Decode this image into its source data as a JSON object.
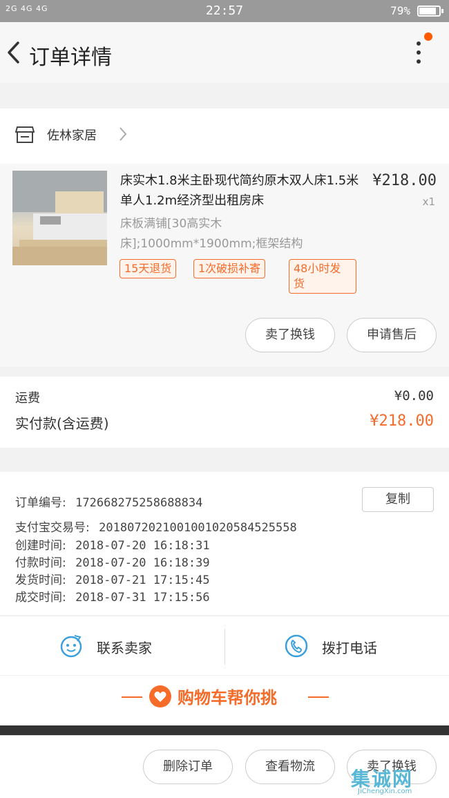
{
  "status_bar": {
    "signal": "2G 4G 4G",
    "time": "22:57",
    "battery_text": "79%",
    "battery_level": 0.79
  },
  "header": {
    "title": "订单详情"
  },
  "shop": {
    "name": "佐林家居"
  },
  "product": {
    "title": "床实木1.8米主卧现代简约原木双人床1.5米单人1.2m经济型出租房床",
    "price": "¥218.00",
    "quantity": "x1",
    "sku": "床板满铺[30高实木床];1000mm*1900mm;框架结构",
    "tags": [
      "15天退货",
      "1次破损补寄",
      "48小时发货"
    ],
    "buttons": {
      "sell_again": "卖了换钱",
      "after_sale": "申请售后"
    }
  },
  "fees": {
    "shipping_label": "运费",
    "shipping_value": "¥0.00",
    "paid_label": "实付款(含运费)",
    "paid_value": "¥218.00"
  },
  "order_info": {
    "order_no_label": "订单编号:",
    "order_no": "172668275258688834",
    "copy_label": "复制",
    "alipay_label": "支付宝交易号:",
    "alipay_no": "2018072021001001020584525558",
    "created_label": "创建时间:",
    "created": "2018-07-20 16:18:31",
    "paid_label": "付款时间:",
    "paid": "2018-07-20 16:18:39",
    "shipped_label": "发货时间:",
    "shipped": "2018-07-21 17:15:45",
    "closed_label": "成交时间:",
    "closed": "2018-07-31 17:15:56"
  },
  "contact": {
    "chat_label": "联系卖家",
    "call_label": "拨打电话"
  },
  "banner": {
    "text": "购物车帮你挑"
  },
  "bottom_bar": {
    "delete": "删除订单",
    "logistics": "查看物流",
    "sell_again": "卖了换钱"
  },
  "watermark": {
    "brand": "集诚网",
    "url": "JiChengXin.com"
  },
  "colors": {
    "accent": "#f46b2a",
    "icon_blue": "#3aa0dd"
  }
}
